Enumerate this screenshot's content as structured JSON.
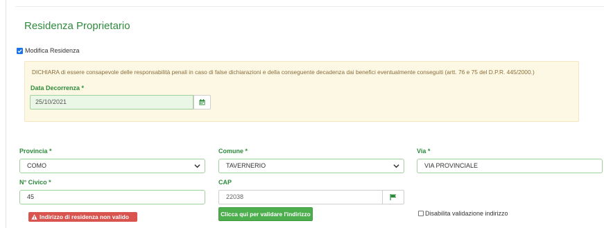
{
  "section": {
    "title": "Residenza Proprietario"
  },
  "modify_residence": {
    "label": "Modifica Residenza",
    "checked": true
  },
  "declaration": {
    "text": "DICHIARA di essere consapevole delle responsabilità penali in caso di false dichiarazioni e della conseguente decadenza dai benefici eventualmente conseguiti (artt. 76 e 75 del D.P.R. 445/2000.)",
    "date_label": "Data Decorrenza *",
    "date_value": "25/10/2021",
    "date_icon": "calendar-icon"
  },
  "address": {
    "provincia": {
      "label": "Provincia *",
      "value": "COMO"
    },
    "comune": {
      "label": "Comune *",
      "value": "TAVERNERIO"
    },
    "via": {
      "label": "Via *",
      "value": "VIA PROVINCIALE"
    },
    "civico": {
      "label": "N° Civico *",
      "value": "45"
    },
    "cap": {
      "label": "CAP",
      "value": "22038",
      "icon": "flag-icon"
    }
  },
  "validation": {
    "error_badge": "Indirizzo di residenza non valido",
    "validate_button": "Clicca qui per validare l'indirizzo",
    "disable_label": "Disabilita validazione indirizzo",
    "disable_checked": false
  },
  "colors": {
    "accent_green": "#2e8b3c",
    "warning_bg": "#fcf8e3",
    "warning_text": "#8a6d3b",
    "error_red": "#d9534f",
    "button_green": "#4cae4c",
    "checkbox_blue": "#1a73e8"
  }
}
